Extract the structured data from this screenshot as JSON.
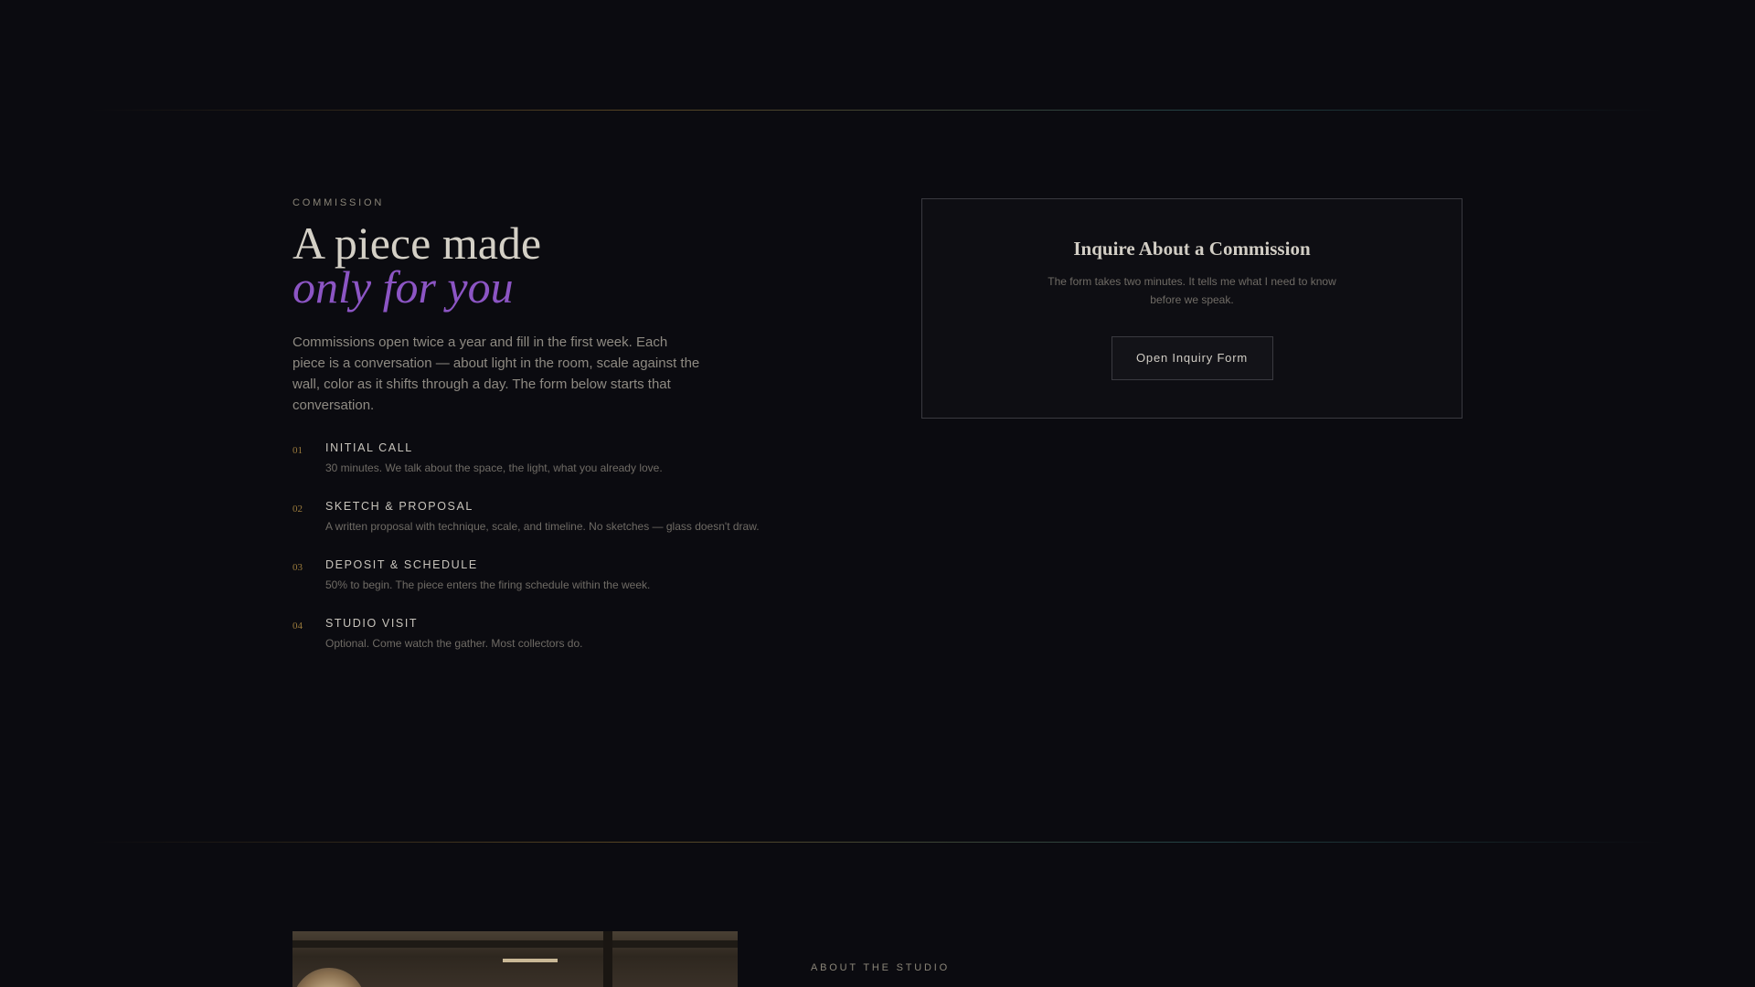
{
  "commission": {
    "eyebrow": "COMMISSION",
    "headline_line1": "A piece made",
    "headline_line2": "only for you",
    "intro": "Commissions open twice a year and fill in the first week. Each piece is a conversation — about light in the room, scale against the wall, color as it shifts through a day. The form below starts that conversation.",
    "steps": [
      {
        "num": "01",
        "title": "INITIAL CALL",
        "desc": "30 minutes. We talk about the space, the light, what you already love."
      },
      {
        "num": "02",
        "title": "SKETCH & PROPOSAL",
        "desc": "A written proposal with technique, scale, and timeline. No sketches — glass doesn't draw."
      },
      {
        "num": "03",
        "title": "DEPOSIT & SCHEDULE",
        "desc": "50% to begin. The piece enters the firing schedule within the week."
      },
      {
        "num": "04",
        "title": "STUDIO VISIT",
        "desc": "Optional. Come watch the gather. Most collectors do."
      }
    ]
  },
  "inquiry_card": {
    "title": "Inquire About a Commission",
    "subtitle": "The form takes two minutes. It tells me what I need to know before we speak.",
    "button_label": "Open Inquiry Form"
  },
  "about": {
    "eyebrow": "ABOUT THE STUDIO"
  },
  "colors": {
    "background": "#0b0b10",
    "accent_purple": "#8c55c4",
    "accent_gold": "#9a7a3c"
  }
}
